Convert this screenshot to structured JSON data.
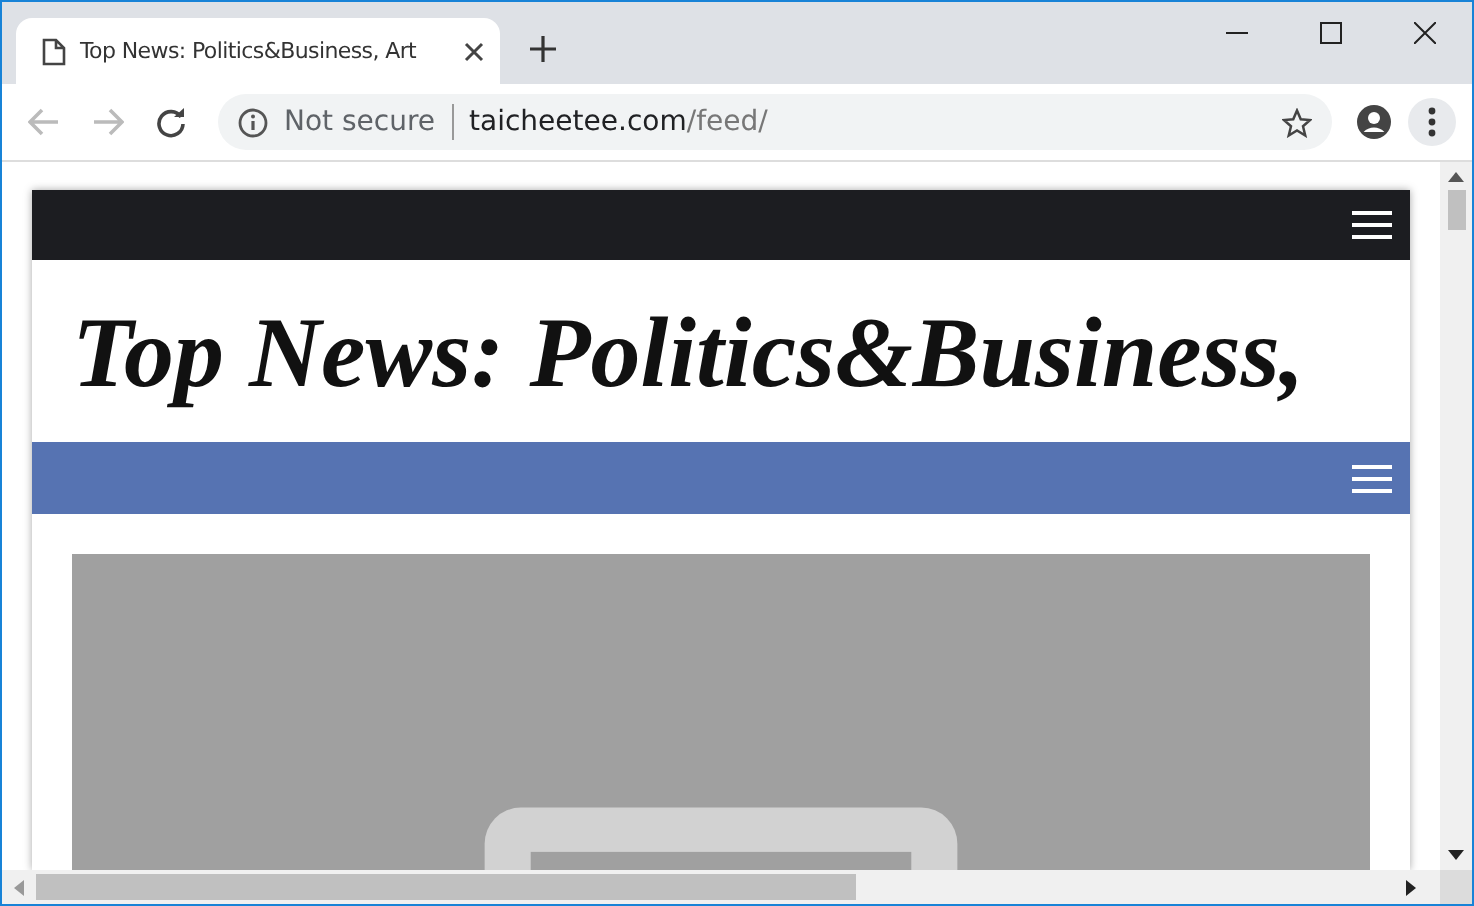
{
  "tabs": [
    {
      "title": "Top News: Politics&Business, Art",
      "selected": true
    }
  ],
  "address_bar": {
    "security": "Not secure",
    "domain": "taicheetee.com",
    "path": "/feed/"
  },
  "page": {
    "title": "Top News: Politics&Business,"
  }
}
